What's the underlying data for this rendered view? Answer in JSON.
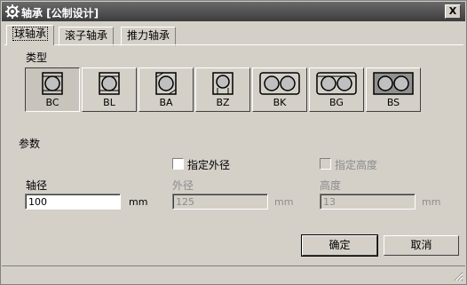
{
  "window": {
    "title": "轴承 [公制设计]",
    "close_label": "X"
  },
  "tabs": [
    {
      "label": "球轴承",
      "active": true
    },
    {
      "label": "滚子轴承",
      "active": false
    },
    {
      "label": "推力轴承",
      "active": false
    }
  ],
  "type_section": {
    "label": "类型"
  },
  "types": [
    {
      "caption": "BC",
      "selected": true
    },
    {
      "caption": "BL",
      "selected": false
    },
    {
      "caption": "BA",
      "selected": false
    },
    {
      "caption": "BZ",
      "selected": false
    },
    {
      "caption": "BK",
      "selected": false
    },
    {
      "caption": "BG",
      "selected": false
    },
    {
      "caption": "BS",
      "selected": false
    }
  ],
  "params": {
    "label": "参数",
    "specify_outer_label": "指定外径",
    "specify_height_label": "指定高度",
    "shaft": {
      "label": "轴径",
      "value": "100",
      "unit": "mm"
    },
    "outer": {
      "label": "外径",
      "value": "125",
      "unit": "mm"
    },
    "height": {
      "label": "高度",
      "value": "13",
      "unit": "mm"
    }
  },
  "buttons": {
    "ok": "确定",
    "cancel": "取消"
  },
  "colors": {
    "titlebar": "#4a4a4a",
    "face": "#d4d0c8"
  },
  "icons": {
    "title": "gear-icon",
    "close": "close-icon"
  }
}
